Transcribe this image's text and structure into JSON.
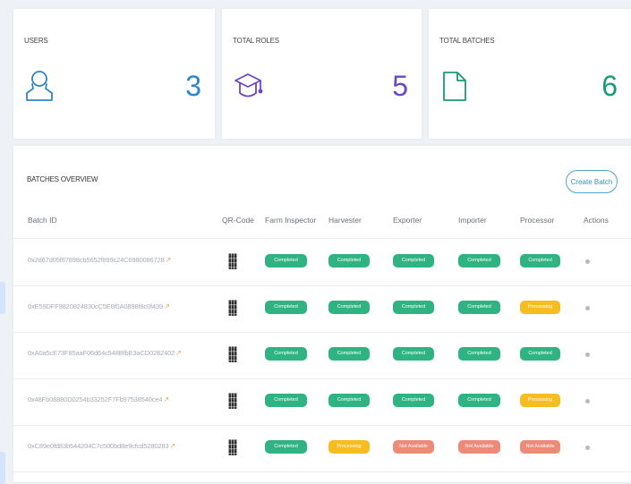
{
  "stats": [
    {
      "title": "USERS",
      "value": "3",
      "icon": "user-icon",
      "color": "#2a86c8"
    },
    {
      "title": "TOTAL ROLES",
      "value": "5",
      "icon": "graduation-cap-icon",
      "color": "#6b47c8"
    },
    {
      "title": "TOTAL BATCHES",
      "value": "6",
      "icon": "document-icon",
      "color": "#1a9a72"
    }
  ],
  "overview": {
    "title": "BATCHES OVERVIEW",
    "create_label": "Create Batch",
    "columns": [
      "Batch ID",
      "QR-Code",
      "Farm Inspector",
      "Harvester",
      "Exporter",
      "Importer",
      "Processor",
      "Actions"
    ],
    "rows": [
      {
        "id": "0x2d67d05f87898cb5652f899c24C6980086728",
        "stages": [
          "Completed",
          "Completed",
          "Completed",
          "Completed",
          "Completed"
        ]
      },
      {
        "id": "0xE59DFF9820824830cC5E8f0A0898f8c0f439",
        "stages": [
          "Completed",
          "Completed",
          "Completed",
          "Completed",
          "Processing"
        ]
      },
      {
        "id": "0xA0a5cE73F85aaF06d64c548BfbE3aCD0282402",
        "stages": [
          "Completed",
          "Completed",
          "Completed",
          "Completed",
          "Completed"
        ]
      },
      {
        "id": "0x48Fb08880D0254b33252F7Fb97538540ce4",
        "stages": [
          "Completed",
          "Completed",
          "Completed",
          "Completed",
          "Processing"
        ]
      },
      {
        "id": "0xC89e0fd83b544204C7c500bd8e9cfcd5280283",
        "stages": [
          "Completed",
          "Processing",
          "Not Available",
          "Not Available",
          "Not Available"
        ]
      }
    ]
  },
  "status_colors": {
    "Completed": "#2fb383",
    "Processing": "#f5bd1f",
    "Not Available": "#ee8a78"
  }
}
